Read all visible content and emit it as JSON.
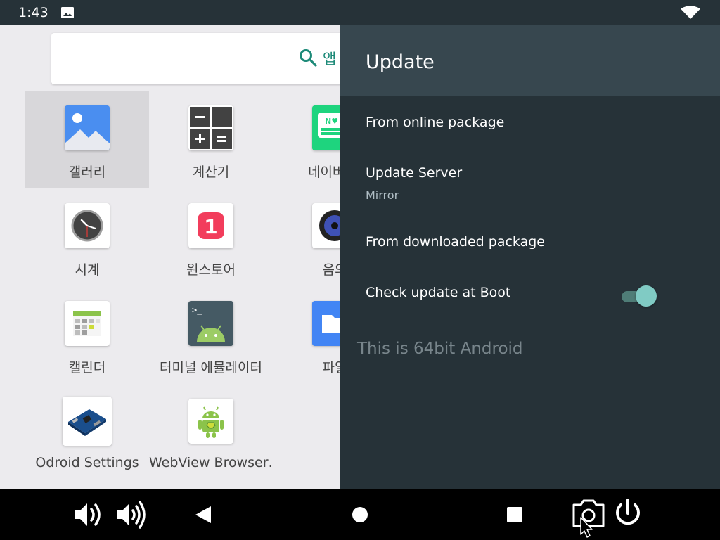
{
  "status_bar": {
    "time": "1:43",
    "icons": [
      "image-icon",
      "wifi-icon"
    ]
  },
  "launcher": {
    "search": {
      "placeholder": "앱"
    },
    "apps": [
      {
        "label": "갤러리",
        "icon": "gallery-icon",
        "selected": true
      },
      {
        "label": "계산기",
        "icon": "calculator-icon"
      },
      {
        "label": "네이버 스",
        "icon": "naver-keyboard-icon"
      },
      {
        "label": "시계",
        "icon": "clock-icon"
      },
      {
        "label": "원스토어",
        "icon": "onestore-icon"
      },
      {
        "label": "음의",
        "icon": "music-icon"
      },
      {
        "label": "캘린더",
        "icon": "calendar-icon"
      },
      {
        "label": "터미널 에뮬레이터",
        "icon": "terminal-icon"
      },
      {
        "label": "파일",
        "icon": "files-icon"
      },
      {
        "label": "Odroid Settings",
        "icon": "odroid-board-icon"
      },
      {
        "label": "WebView Browser…",
        "icon": "android-webview-icon"
      }
    ]
  },
  "panel": {
    "title": "Update",
    "items": [
      {
        "title": "From online package"
      },
      {
        "title": "Update Server",
        "summary": "Mirror"
      },
      {
        "title": "From downloaded package"
      },
      {
        "title": "Check update at Boot",
        "toggle": true
      }
    ],
    "footer": "This is 64bit Android"
  },
  "nav_bar": {
    "buttons": [
      "volume-down-icon",
      "volume-up-icon",
      "back-icon",
      "home-icon",
      "recents-icon",
      "screenshot-icon",
      "power-icon"
    ]
  },
  "colors": {
    "accent": "#80cbc4",
    "panel_bg": "#263238",
    "panel_header": "#37474f",
    "launcher_bg": "#ecebee",
    "search_accent": "#1d8a78"
  }
}
